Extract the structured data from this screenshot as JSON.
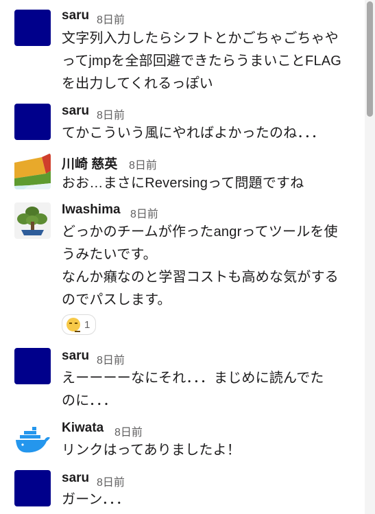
{
  "messages": [
    {
      "author": "saru",
      "time": "8日前",
      "avatar": "navy-square",
      "lines": [
        "文字列入力したらシフトとかごちゃごちゃや",
        "ってjmpを全部回避できたらうまいことFLAG",
        "を出力してくれるっぽい"
      ]
    },
    {
      "author": "saru",
      "time": "8日前",
      "avatar": "navy-square",
      "lines": [
        "てかこういう風にやればよかったのね．．．"
      ]
    },
    {
      "author": "川崎 慈英",
      "time": "8日前",
      "avatar": "colored-tile",
      "lines": [
        "おお…まさにReversingって問題ですね"
      ]
    },
    {
      "author": "Iwashima",
      "time": "8日前",
      "avatar": "bonsai-tree",
      "lines": [
        "どっかのチームが作ったangrってツールを使",
        "うみたいです。",
        "なんか癪なのと学習コストも高めな気がする",
        "のでパスします。"
      ],
      "reaction": {
        "emoji": "expressionless-face",
        "count": "1"
      }
    },
    {
      "author": "saru",
      "time": "8日前",
      "avatar": "navy-square",
      "lines": [
        "えーーーーなにそれ．．．まじめに読んでた",
        "のに．．．"
      ]
    },
    {
      "author": "Kiwata",
      "time": "8日前",
      "avatar": "docker-whale",
      "lines": [
        "リンクはってありましたよ！"
      ]
    },
    {
      "author": "saru",
      "time": "8日前",
      "avatar": "navy-square",
      "lines": [
        "ガーン．．．"
      ]
    }
  ],
  "colors": {
    "navy_avatar": "#00008b",
    "text": "#1d1c1d",
    "muted": "#616061"
  }
}
